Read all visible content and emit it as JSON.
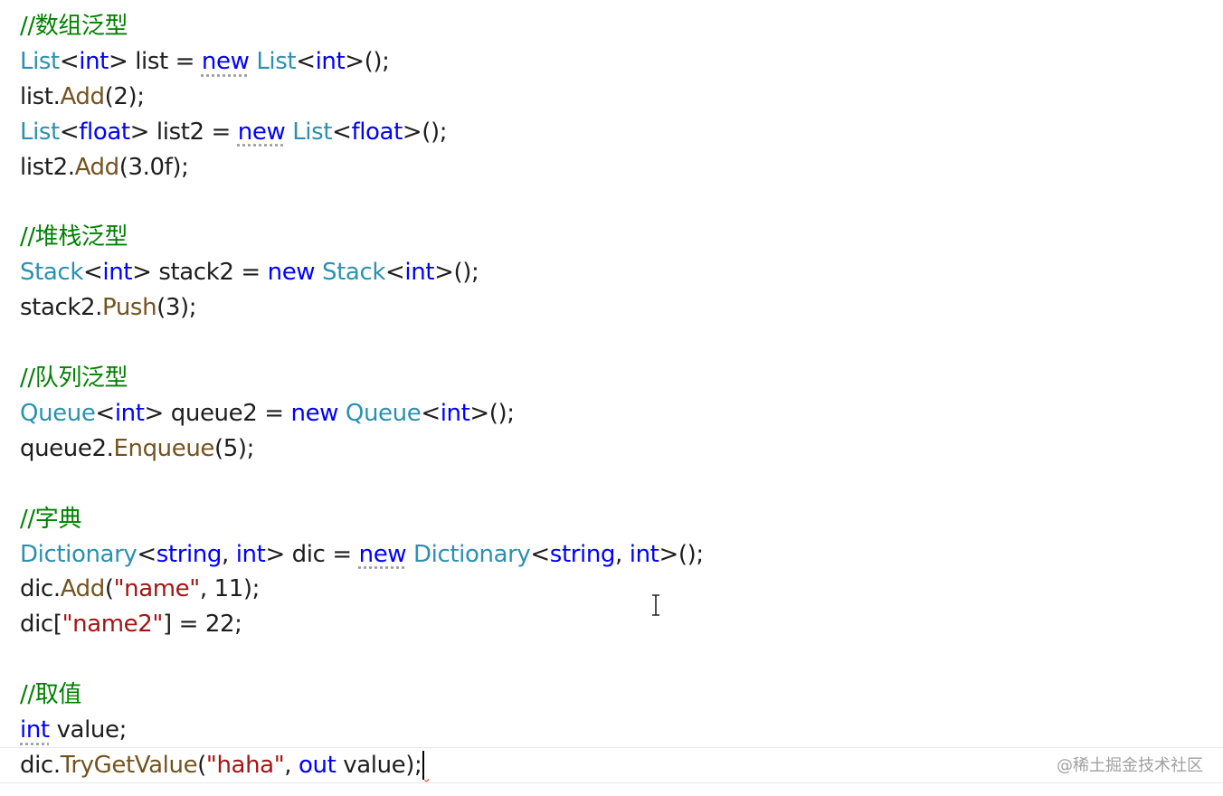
{
  "editor": {
    "lines": [
      {
        "tokens": [
          {
            "t": "//数组泛型",
            "c": "comment"
          }
        ]
      },
      {
        "tokens": [
          {
            "t": "List",
            "c": "type"
          },
          {
            "t": "<",
            "c": "plain"
          },
          {
            "t": "int",
            "c": "keyword"
          },
          {
            "t": "> list = ",
            "c": "plain"
          },
          {
            "t": "new",
            "c": "keyword",
            "dotted": true
          },
          {
            "t": " ",
            "c": "plain"
          },
          {
            "t": "List",
            "c": "type"
          },
          {
            "t": "<",
            "c": "plain"
          },
          {
            "t": "int",
            "c": "keyword"
          },
          {
            "t": ">();",
            "c": "plain"
          }
        ]
      },
      {
        "tokens": [
          {
            "t": "list.",
            "c": "plain"
          },
          {
            "t": "Add",
            "c": "method"
          },
          {
            "t": "(2);",
            "c": "plain"
          }
        ]
      },
      {
        "tokens": [
          {
            "t": "List",
            "c": "type"
          },
          {
            "t": "<",
            "c": "plain"
          },
          {
            "t": "float",
            "c": "keyword"
          },
          {
            "t": "> list2 = ",
            "c": "plain"
          },
          {
            "t": "new",
            "c": "keyword",
            "dotted": true
          },
          {
            "t": " ",
            "c": "plain"
          },
          {
            "t": "List",
            "c": "type"
          },
          {
            "t": "<",
            "c": "plain"
          },
          {
            "t": "float",
            "c": "keyword"
          },
          {
            "t": ">();",
            "c": "plain"
          }
        ]
      },
      {
        "tokens": [
          {
            "t": "list2.",
            "c": "plain"
          },
          {
            "t": "Add",
            "c": "method"
          },
          {
            "t": "(3.0f);",
            "c": "plain"
          }
        ]
      },
      {
        "tokens": []
      },
      {
        "tokens": [
          {
            "t": "//堆栈泛型",
            "c": "comment"
          }
        ]
      },
      {
        "tokens": [
          {
            "t": "Stack",
            "c": "type"
          },
          {
            "t": "<",
            "c": "plain"
          },
          {
            "t": "int",
            "c": "keyword"
          },
          {
            "t": "> stack2 = ",
            "c": "plain"
          },
          {
            "t": "new",
            "c": "keyword"
          },
          {
            "t": " ",
            "c": "plain"
          },
          {
            "t": "Stack",
            "c": "type"
          },
          {
            "t": "<",
            "c": "plain"
          },
          {
            "t": "int",
            "c": "keyword"
          },
          {
            "t": ">();",
            "c": "plain"
          }
        ]
      },
      {
        "tokens": [
          {
            "t": "stack2.",
            "c": "plain"
          },
          {
            "t": "Push",
            "c": "method"
          },
          {
            "t": "(3);",
            "c": "plain"
          }
        ]
      },
      {
        "tokens": []
      },
      {
        "tokens": [
          {
            "t": "//队列泛型",
            "c": "comment"
          }
        ]
      },
      {
        "tokens": [
          {
            "t": "Queue",
            "c": "type"
          },
          {
            "t": "<",
            "c": "plain"
          },
          {
            "t": "int",
            "c": "keyword"
          },
          {
            "t": "> queue2 = ",
            "c": "plain"
          },
          {
            "t": "new",
            "c": "keyword"
          },
          {
            "t": " ",
            "c": "plain"
          },
          {
            "t": "Queue",
            "c": "type"
          },
          {
            "t": "<",
            "c": "plain"
          },
          {
            "t": "int",
            "c": "keyword"
          },
          {
            "t": ">();",
            "c": "plain"
          }
        ]
      },
      {
        "tokens": [
          {
            "t": "queue2.",
            "c": "plain"
          },
          {
            "t": "Enqueue",
            "c": "method"
          },
          {
            "t": "(5);",
            "c": "plain"
          }
        ]
      },
      {
        "tokens": []
      },
      {
        "tokens": [
          {
            "t": "//字典",
            "c": "comment"
          }
        ]
      },
      {
        "tokens": [
          {
            "t": "Dictionary",
            "c": "type"
          },
          {
            "t": "<",
            "c": "plain"
          },
          {
            "t": "string",
            "c": "keyword"
          },
          {
            "t": ", ",
            "c": "plain"
          },
          {
            "t": "int",
            "c": "keyword"
          },
          {
            "t": "> dic = ",
            "c": "plain"
          },
          {
            "t": "new",
            "c": "keyword",
            "dotted": true
          },
          {
            "t": " ",
            "c": "plain"
          },
          {
            "t": "Dictionary",
            "c": "type"
          },
          {
            "t": "<",
            "c": "plain"
          },
          {
            "t": "string",
            "c": "keyword"
          },
          {
            "t": ", ",
            "c": "plain"
          },
          {
            "t": "int",
            "c": "keyword"
          },
          {
            "t": ">();",
            "c": "plain"
          }
        ]
      },
      {
        "tokens": [
          {
            "t": "dic.",
            "c": "plain"
          },
          {
            "t": "Add",
            "c": "method"
          },
          {
            "t": "(",
            "c": "plain"
          },
          {
            "t": "\"name\"",
            "c": "string"
          },
          {
            "t": ", 11);",
            "c": "plain"
          }
        ]
      },
      {
        "tokens": [
          {
            "t": "dic[",
            "c": "plain"
          },
          {
            "t": "\"name2\"",
            "c": "string"
          },
          {
            "t": "] = 22;",
            "c": "plain"
          }
        ]
      },
      {
        "tokens": []
      },
      {
        "tokens": [
          {
            "t": "//取值",
            "c": "comment"
          }
        ]
      },
      {
        "tokens": [
          {
            "t": "int",
            "c": "keyword",
            "dotted": true
          },
          {
            "t": " value;",
            "c": "plain"
          }
        ]
      },
      {
        "tokens": [
          {
            "t": "dic.",
            "c": "plain"
          },
          {
            "t": "TryGetValue",
            "c": "method"
          },
          {
            "t": "(",
            "c": "plain"
          },
          {
            "t": "\"haha\"",
            "c": "string"
          },
          {
            "t": ", ",
            "c": "plain"
          },
          {
            "t": "out",
            "c": "keyword"
          },
          {
            "t": " value);",
            "c": "plain"
          }
        ],
        "current": true,
        "caret": true
      }
    ]
  },
  "watermark": "@稀土掘金技术社区",
  "colors": {
    "comment": "#008000",
    "type": "#2b91af",
    "keyword": "#0000ff",
    "method": "#74531f",
    "string": "#a31515",
    "plain": "#1e1e1e"
  }
}
